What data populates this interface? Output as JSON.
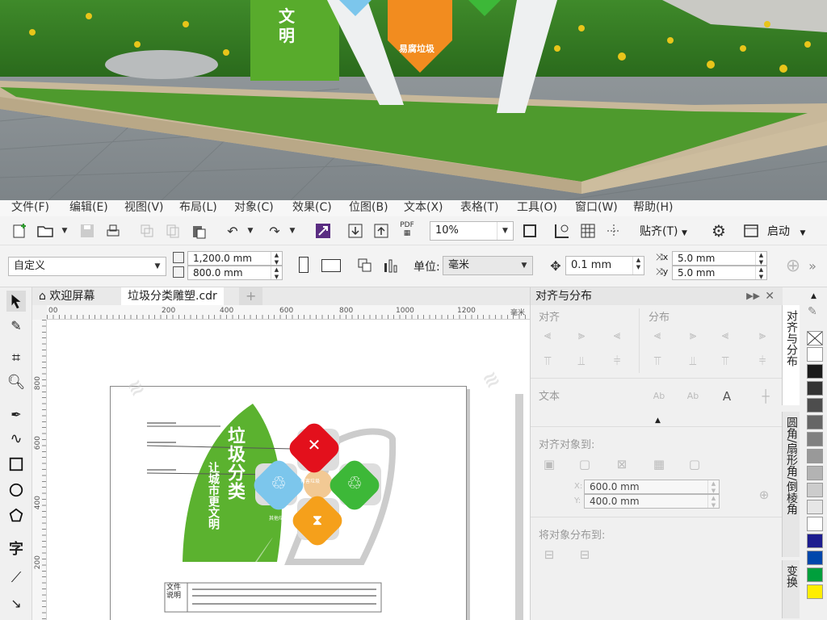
{
  "scene": {
    "sign_text_vertical": "文明",
    "sign_text_badge": "易腐垃圾"
  },
  "menu": [
    {
      "label": "文件(F)"
    },
    {
      "label": "编辑(E)"
    },
    {
      "label": "视图(V)"
    },
    {
      "label": "布局(L)"
    },
    {
      "label": "对象(C)"
    },
    {
      "label": "效果(C)"
    },
    {
      "label": "位图(B)"
    },
    {
      "label": "文本(X)"
    },
    {
      "label": "表格(T)"
    },
    {
      "label": "工具(O)"
    },
    {
      "label": "窗口(W)"
    },
    {
      "label": "帮助(H)"
    }
  ],
  "toolbar": {
    "pdf_label": "PDF",
    "zoom_value": "10%",
    "snap_label": "贴齐(T)",
    "launch_label": "启动"
  },
  "propbar": {
    "preset": "自定义",
    "width": "1,200.0 mm",
    "height": "800.0 mm",
    "unit_label": "单位:",
    "unit_value": "毫米",
    "nudge": "0.1 mm",
    "dup_x": "5.0 mm",
    "dup_y": "5.0 mm"
  },
  "tabs": {
    "welcome": "欢迎屏幕",
    "doc": "垃圾分类雕塑.cdr",
    "add": "+"
  },
  "ruler": {
    "h_ticks": [
      "00",
      "200",
      "400",
      "600",
      "800",
      "1000",
      "1200"
    ],
    "h_unit": "毫米",
    "v_ticks": [
      "800",
      "600",
      "400",
      "200"
    ]
  },
  "artboard": {
    "title": "垃圾分类",
    "subtitle": "让城市更文明",
    "note_label_1": "文件",
    "note_label_2": "说明",
    "badges": [
      {
        "name": "有害垃圾",
        "color": "#e3101c"
      },
      {
        "name": "可回收物",
        "color": "#3db838"
      },
      {
        "name": "其他垃圾",
        "color": "#7cc6ec"
      },
      {
        "name": "易腐垃圾",
        "color": "#f5a01b"
      }
    ],
    "leaf_color": "#5bb22f"
  },
  "panel": {
    "title": "对齐与分布",
    "align_label": "对齐",
    "dist_label": "分布",
    "text_label": "文本",
    "align_to_label": "对齐对象到:",
    "x_value": "600.0 mm",
    "y_value": "400.0 mm",
    "x_label": "X:",
    "y_label": "Y:",
    "distribute_to_label": "将对象分布到:"
  },
  "docker_tabs": [
    {
      "label": "对齐与分布"
    },
    {
      "label": "圆角/扇形角/倒棱角"
    },
    {
      "label": "变换"
    }
  ],
  "palette": [
    "#ffffff",
    "#1a1a1a",
    "#333333",
    "#4d4d4d",
    "#666666",
    "#808080",
    "#999999",
    "#b3b3b3",
    "#cccccc",
    "#e6e6e6",
    "#ffffff",
    "#1d1d8f",
    "#0047ab",
    "#009f3c",
    "#ffee00"
  ]
}
